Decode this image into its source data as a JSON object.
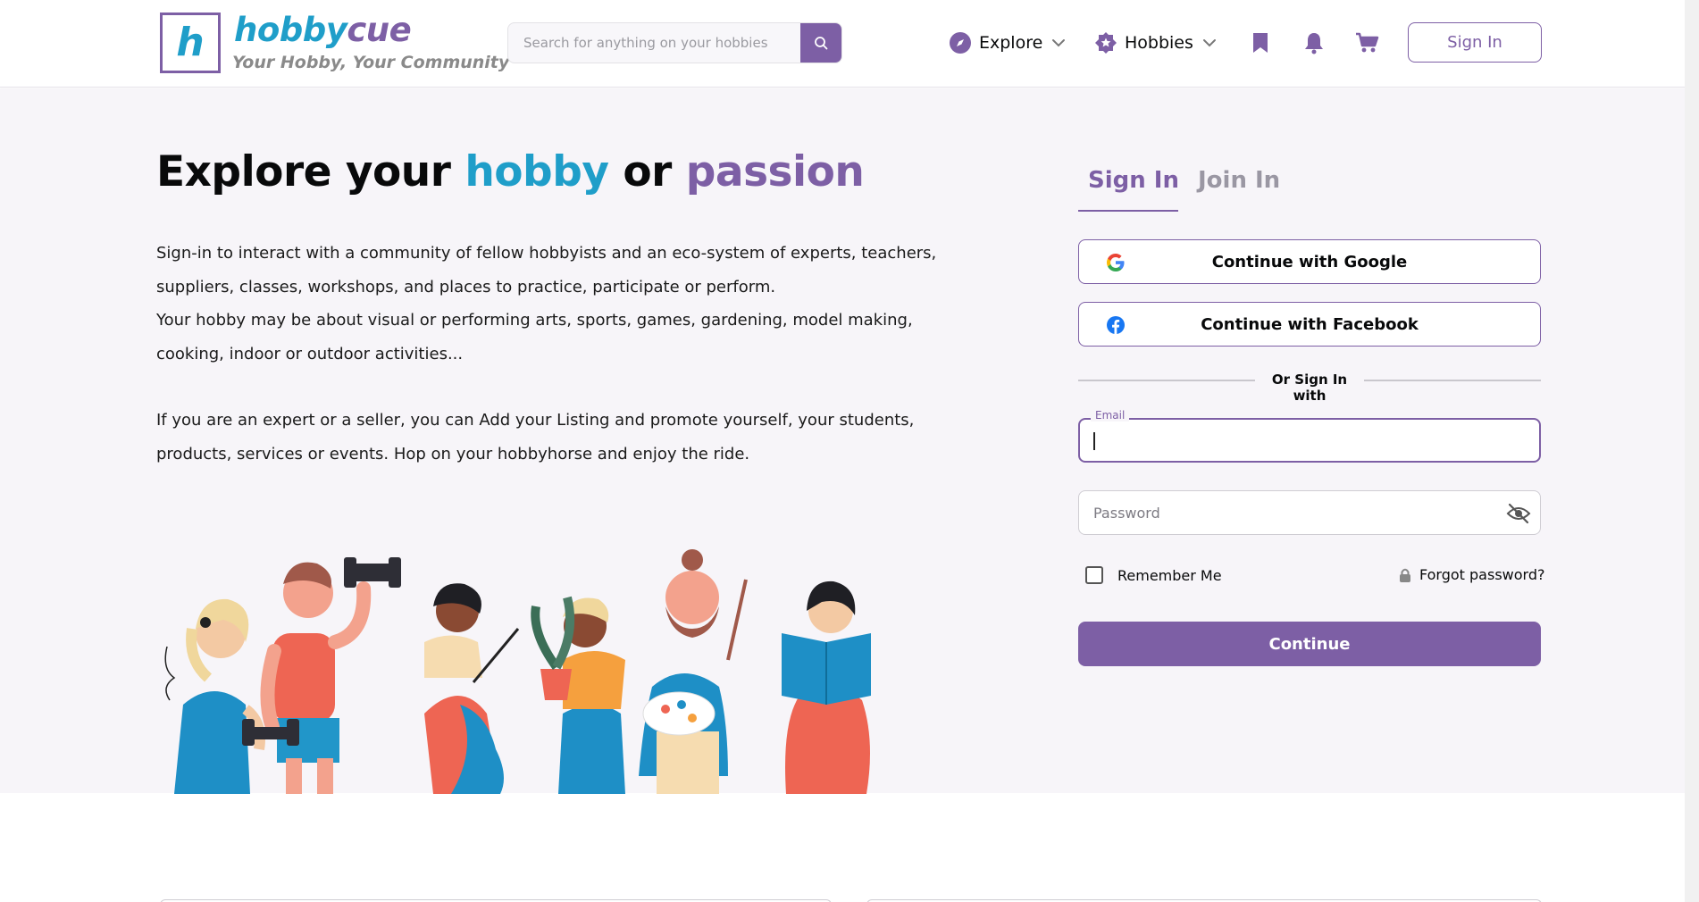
{
  "brand": {
    "logo_letter": "h",
    "name_part1": "hobby",
    "name_part2": "cue",
    "tagline": "Your Hobby, Your Community"
  },
  "search": {
    "placeholder": "Search for anything on your hobbies",
    "icon": "search-icon"
  },
  "nav": {
    "explore_label": "Explore",
    "hobbies_label": "Hobbies",
    "bookmark_icon": "bookmark-icon",
    "bell_icon": "bell-icon",
    "cart_icon": "cart-icon",
    "signin_label": "Sign In"
  },
  "hero": {
    "title_part1": "Explore your ",
    "title_part2": "hobby",
    "title_part3": " or ",
    "title_part4": "passion",
    "paragraph1": "Sign-in to interact with a community of fellow hobbyists and an eco-system of experts, teachers, suppliers, classes, workshops, and places to practice, participate or perform.",
    "paragraph2": "Your hobby may be about visual or performing arts, sports, games, gardening, model making, cooking, indoor or outdoor activities...",
    "paragraph3": "If you are an expert or a seller, you can Add your Listing and promote yourself, your students, products, services or events. Hop on your hobbyhorse and enjoy the ride."
  },
  "auth": {
    "tab_signin": "Sign In",
    "tab_join": "Join In",
    "google_label": "Continue with Google",
    "facebook_label": "Continue with Facebook",
    "divider_text": "Or Sign In with",
    "email_label": "Email",
    "email_value": "",
    "password_placeholder": "Password",
    "remember_label": "Remember Me",
    "forgot_label": "Forgot password?",
    "continue_label": "Continue"
  },
  "colors": {
    "brand_purple": "#7d5fa5",
    "brand_blue": "#1f9ec9",
    "hero_bg": "#f7f5f9"
  }
}
